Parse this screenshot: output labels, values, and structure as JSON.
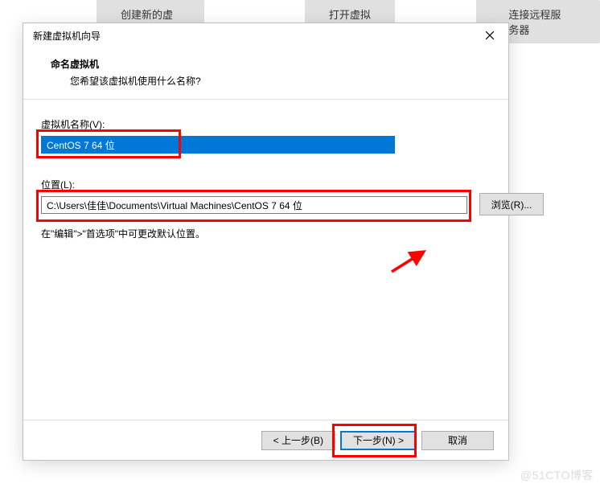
{
  "background": {
    "btn1": "创建新的虚拟机",
    "btn2": "打开虚拟机",
    "btn3": "连接远程服务器"
  },
  "dialog": {
    "title": "新建虚拟机向导",
    "header": {
      "title": "命名虚拟机",
      "subtitle": "您希望该虚拟机使用什么名称?"
    },
    "fields": {
      "name_label": "虚拟机名称(V):",
      "name_value": "CentOS 7 64 位",
      "location_label": "位置(L):",
      "location_value": "C:\\Users\\佳佳\\Documents\\Virtual Machines\\CentOS 7 64 位",
      "browse_label": "浏览(R)...",
      "hint": "在\"编辑\">\"首选项\"中可更改默认位置。"
    },
    "buttons": {
      "back": "< 上一步(B)",
      "next": "下一步(N) >",
      "cancel": "取消"
    }
  },
  "watermark": "@51CTO博客"
}
